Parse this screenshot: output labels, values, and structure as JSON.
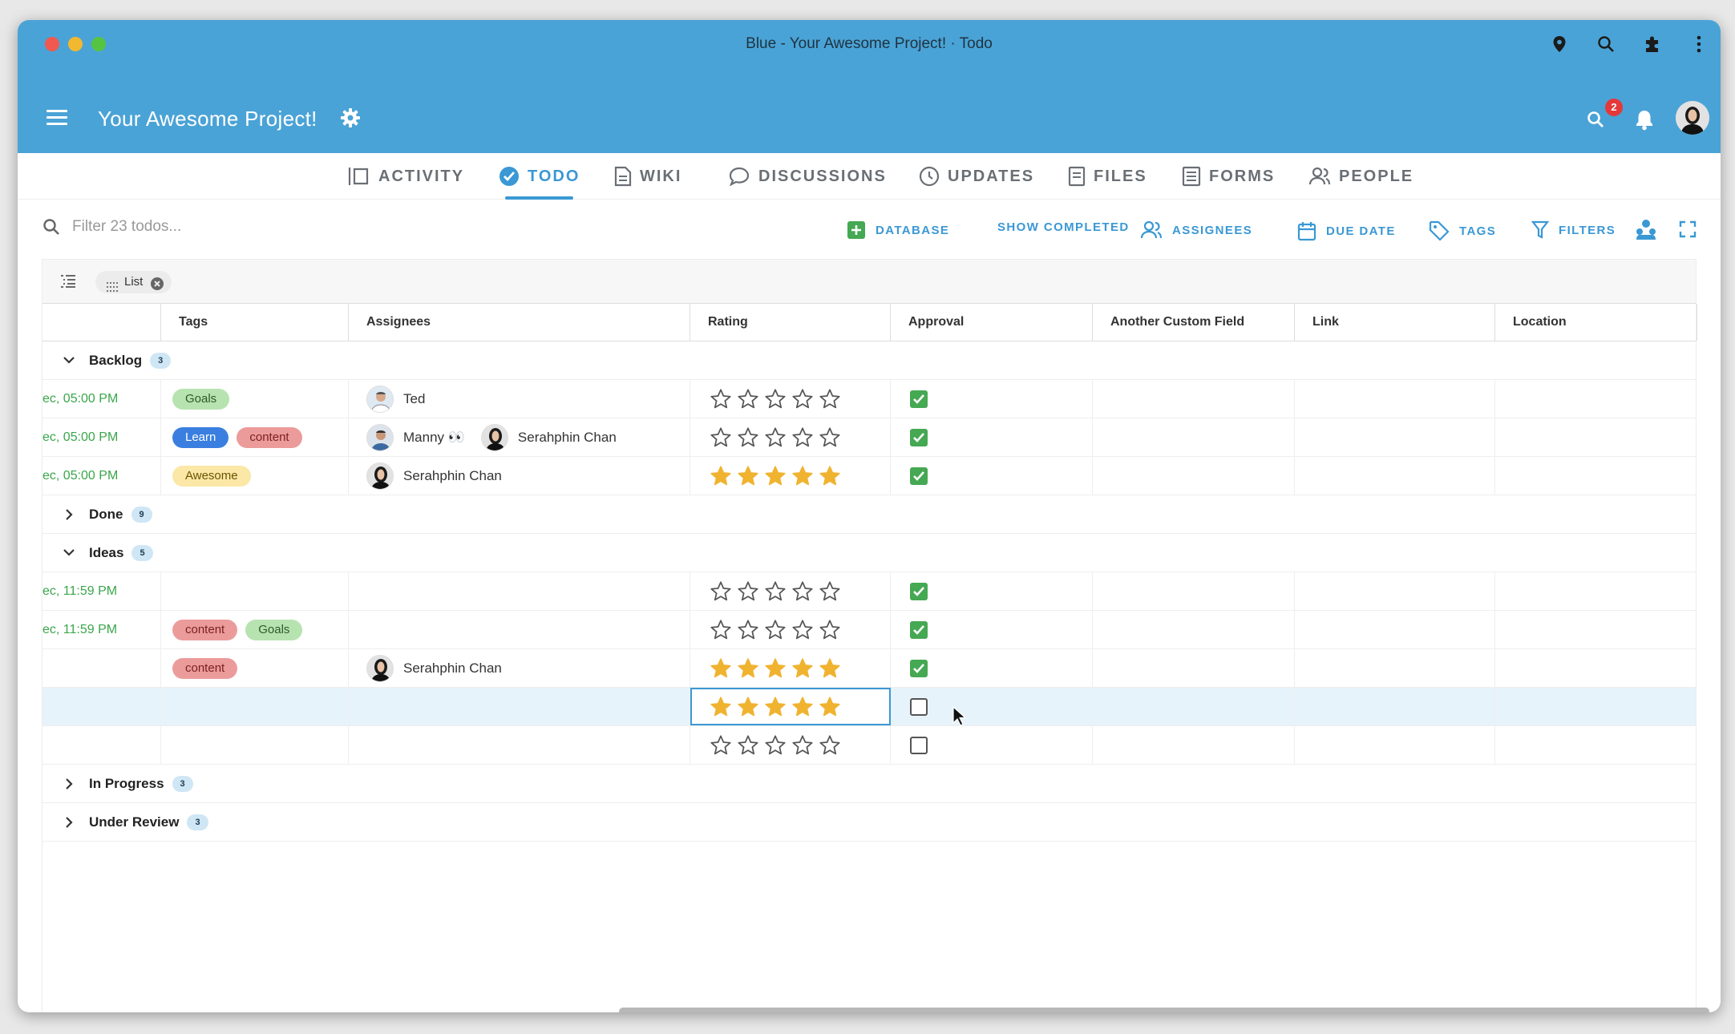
{
  "window": {
    "title": "Blue - Your Awesome Project! · Todo"
  },
  "browser_icons": [
    "location-pin-icon",
    "zoom-icon",
    "extension-icon",
    "more-icon"
  ],
  "app": {
    "project_title": "Your Awesome Project!",
    "notification_count": "2"
  },
  "tabs": [
    {
      "label": "ACTIVITY",
      "icon": "activity-icon"
    },
    {
      "label": "TODO",
      "icon": "todo-check-icon",
      "active": true
    },
    {
      "label": "WIKI",
      "icon": "wiki-icon"
    },
    {
      "label": "DISCUSSIONS",
      "icon": "discussions-icon"
    },
    {
      "label": "UPDATES",
      "icon": "updates-icon"
    },
    {
      "label": "FILES",
      "icon": "files-icon"
    },
    {
      "label": "FORMS",
      "icon": "forms-icon"
    },
    {
      "label": "PEOPLE",
      "icon": "people-icon"
    }
  ],
  "toolbar": {
    "search_placeholder": "Filter 23 todos...",
    "database": "DATABASE",
    "show_completed": "SHOW COMPLETED",
    "assignees": "ASSIGNEES",
    "due_date": "DUE DATE",
    "tags": "TAGS",
    "filters": "FILTERS"
  },
  "view": {
    "chip_label": "List"
  },
  "columns": [
    "Tags",
    "Assignees",
    "Rating",
    "Approval",
    "Another Custom Field",
    "Link",
    "Location"
  ],
  "groups": [
    {
      "name": "Backlog",
      "count": "3",
      "expanded": true
    },
    {
      "name": "Done",
      "count": "9",
      "expanded": false
    },
    {
      "name": "Ideas",
      "count": "5",
      "expanded": true
    },
    {
      "name": "In Progress",
      "count": "3",
      "expanded": false
    },
    {
      "name": "Under Review",
      "count": "3",
      "expanded": false
    }
  ],
  "rows": {
    "backlog": [
      {
        "date": "ec, 05:00 PM",
        "tags": [
          "Goals"
        ],
        "assignees": [
          "Ted"
        ],
        "rating": 0,
        "approved": true
      },
      {
        "date": "ec, 05:00 PM",
        "tags": [
          "Learn",
          "content"
        ],
        "assignees": [
          "Manny 👀",
          "Serahphin Chan"
        ],
        "rating": 0,
        "approved": true
      },
      {
        "date": "ec, 05:00 PM",
        "tags": [
          "Awesome"
        ],
        "assignees": [
          "Serahphin Chan"
        ],
        "rating": 5,
        "approved": true
      }
    ],
    "ideas": [
      {
        "date": "ec, 11:59 PM",
        "tags": [],
        "assignees": [],
        "rating": 0,
        "approved": true
      },
      {
        "date": "ec, 11:59 PM",
        "tags": [
          "content",
          "Goals"
        ],
        "assignees": [],
        "rating": 0,
        "approved": true
      },
      {
        "date": "",
        "tags": [
          "content"
        ],
        "assignees": [
          "Serahphin Chan"
        ],
        "rating": 5,
        "approved": true
      },
      {
        "date": "",
        "tags": [],
        "assignees": [],
        "rating": 5,
        "approved": false,
        "selected": true
      },
      {
        "date": "",
        "tags": [],
        "assignees": [],
        "rating": 0,
        "approved": false
      }
    ]
  },
  "colors": {
    "header_blue": "#4aa3d6",
    "accent": "#3a98d4",
    "star_filled": "#f0b330",
    "check_green": "#45a853",
    "date_green": "#3aa64b"
  }
}
